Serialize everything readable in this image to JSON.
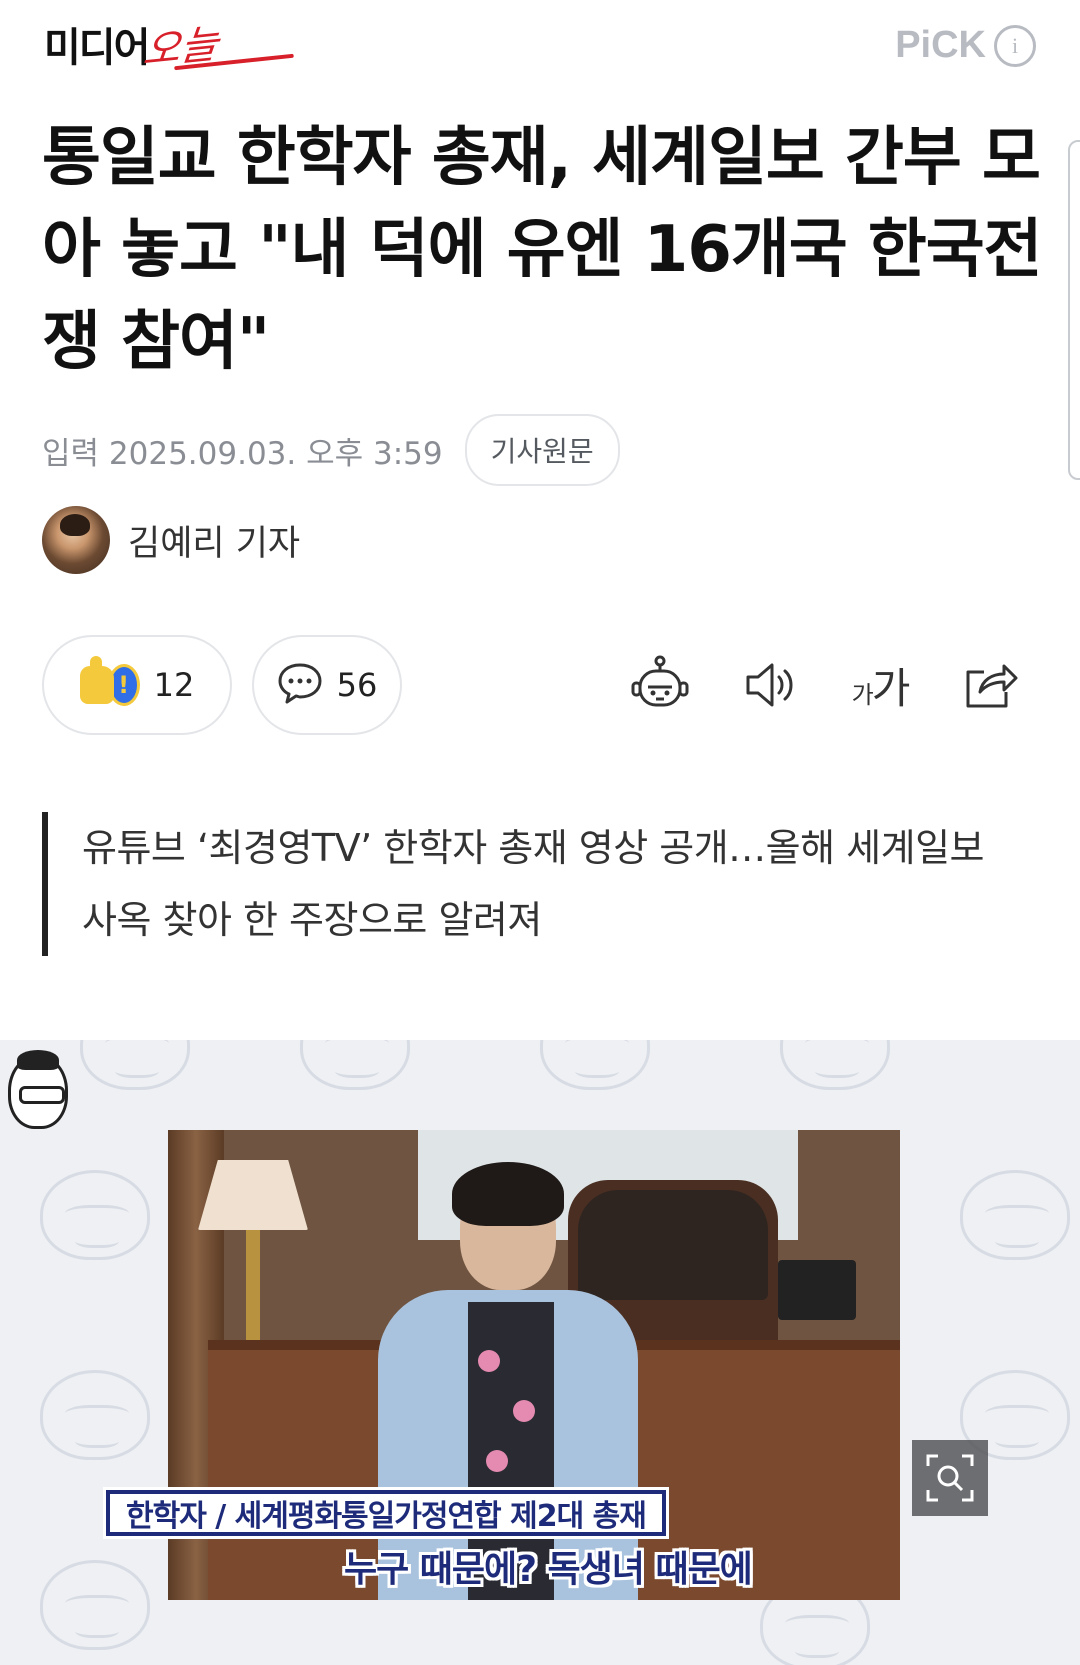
{
  "header": {
    "logo_main": "미디어",
    "logo_script": "오늘",
    "pick_label": "PiCK",
    "pick_info": "i"
  },
  "article": {
    "title": "통일교 한학자 총재, 세계일보 간부 모아 놓고 \"내 덕에 유엔 16개국 한국전쟁 참여\"",
    "date": "입력 2025.09.03. 오후 3:59",
    "original_button": "기사원문",
    "author": "김예리 기자",
    "reaction_count": "12",
    "comment_count": "56",
    "font_size_label_small": "가",
    "font_size_label_large": "가",
    "summary": "유튜브 ‘최경영TV’ 한학자 총재 영상 공개…올해 세계일보 사옥 찾아 한 주장으로 알려져"
  },
  "photo": {
    "caption_top": "한학자 / 세계평화통일가정연합 제2대 총재",
    "caption_bottom": "누구 때문에? 독생녀 때문에"
  },
  "colors": {
    "brand_red": "#d8202a",
    "pick_gray": "#b8bcc2",
    "caption_navy": "#1d2b7a"
  },
  "icons": [
    "thumbs-up-icon",
    "exclamation-icon",
    "comment-icon",
    "robot-summary-icon",
    "speaker-icon",
    "font-size-icon",
    "share-icon",
    "zoom-icon",
    "info-icon"
  ]
}
